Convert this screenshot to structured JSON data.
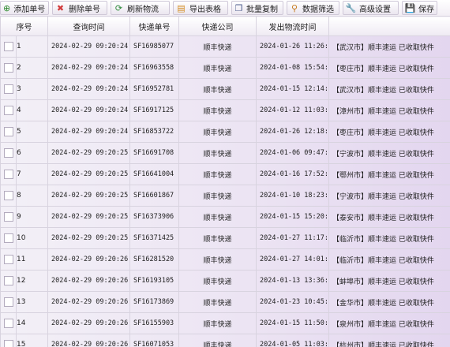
{
  "toolbar": [
    {
      "label": "添加单号",
      "icon": "add-icon",
      "glyph": "⊕",
      "color": "#2e8b2e"
    },
    {
      "label": "删除单号",
      "icon": "delete-icon",
      "glyph": "✖",
      "color": "#d23b3b"
    },
    {
      "label": "刷新物流",
      "icon": "refresh-icon",
      "glyph": "⟳",
      "color": "#2f8a3a"
    },
    {
      "label": "导出表格",
      "icon": "export-icon",
      "glyph": "▤",
      "color": "#d38b1f"
    },
    {
      "label": "批量复制",
      "icon": "copy-icon",
      "glyph": "❐",
      "color": "#4a5a8a"
    },
    {
      "label": "数据筛选",
      "icon": "filter-icon",
      "glyph": "⚲",
      "color": "#c67a1c"
    },
    {
      "label": "高级设置",
      "icon": "wrench-icon",
      "glyph": "🔧",
      "color": "#6a6a6a"
    },
    {
      "label": "保存",
      "icon": "save-icon",
      "glyph": "💾",
      "color": "#2f5fa8"
    }
  ],
  "table": {
    "headers": [
      "序号",
      "查询时间",
      "快递单号",
      "快递公司",
      "发出物流时间",
      ""
    ],
    "rows": [
      {
        "idx": "1",
        "time": "2024-02-29 09:20:24",
        "num": "SF16985077",
        "co": "顺丰快递",
        "sent": "2024-01-26 11:26:0",
        "loc": "【武汉市】顺丰速运 已收取快件"
      },
      {
        "idx": "2",
        "time": "2024-02-29 09:20:24",
        "num": "SF16963558",
        "co": "顺丰快递",
        "sent": "2024-01-08 15:54:4",
        "loc": "【枣庄市】顺丰速运 已收取快件"
      },
      {
        "idx": "3",
        "time": "2024-02-29 09:20:24",
        "num": "SF16952781",
        "co": "顺丰快递",
        "sent": "2024-01-15 12:14:0",
        "loc": "【武汉市】顺丰速运 已收取快件"
      },
      {
        "idx": "4",
        "time": "2024-02-29 09:20:24",
        "num": "SF16917125",
        "co": "顺丰快递",
        "sent": "2024-01-12 11:03:3",
        "loc": "【漳州市】顺丰速运 已收取快件"
      },
      {
        "idx": "5",
        "time": "2024-02-29 09:20:24",
        "num": "SF16853722",
        "co": "顺丰快递",
        "sent": "2024-01-26 12:18:0",
        "loc": "【枣庄市】顺丰速运 已收取快件"
      },
      {
        "idx": "6",
        "time": "2024-02-29 09:20:25",
        "num": "SF16691708",
        "co": "顺丰快递",
        "sent": "2024-01-06 09:47:4",
        "loc": "【宁波市】顺丰速运 已收取快件"
      },
      {
        "idx": "7",
        "time": "2024-02-29 09:20:25",
        "num": "SF16641004",
        "co": "顺丰快递",
        "sent": "2024-01-16 17:52:4",
        "loc": "【鄂州市】顺丰速运 已收取快件"
      },
      {
        "idx": "8",
        "time": "2024-02-29 09:20:25",
        "num": "SF16601867",
        "co": "顺丰快递",
        "sent": "2024-01-10 18:23:4",
        "loc": "【宁波市】顺丰速运 已收取快件"
      },
      {
        "idx": "9",
        "time": "2024-02-29 09:20:25",
        "num": "SF16373906",
        "co": "顺丰快递",
        "sent": "2024-01-15 15:20:0",
        "loc": "【泰安市】顺丰速运 已收取快件"
      },
      {
        "idx": "10",
        "time": "2024-02-29 09:20:25",
        "num": "SF16371425",
        "co": "顺丰快递",
        "sent": "2024-01-27 11:17:5",
        "loc": "【临沂市】顺丰速运 已收取快件"
      },
      {
        "idx": "11",
        "time": "2024-02-29 09:20:26",
        "num": "SF16281520",
        "co": "顺丰快递",
        "sent": "2024-01-27 14:01:2",
        "loc": "【临沂市】顺丰速运 已收取快件"
      },
      {
        "idx": "12",
        "time": "2024-02-29 09:20:26",
        "num": "SF16193105",
        "co": "顺丰快递",
        "sent": "2024-01-13 13:36:1",
        "loc": "【蚌埠市】顺丰速运 已收取快件"
      },
      {
        "idx": "13",
        "time": "2024-02-29 09:20:26",
        "num": "SF16173869",
        "co": "顺丰快递",
        "sent": "2024-01-23 10:45:2",
        "loc": "【金华市】顺丰速运 已收取快件"
      },
      {
        "idx": "14",
        "time": "2024-02-29 09:20:26",
        "num": "SF16155903",
        "co": "顺丰快递",
        "sent": "2024-01-15 11:50:2",
        "loc": "【泉州市】顺丰速运 已收取快件"
      },
      {
        "idx": "15",
        "time": "2024-02-29 09:20:26",
        "num": "SF16071053",
        "co": "顺丰快递",
        "sent": "2024-01-05 11:03:3",
        "loc": "【杭州市】顺丰速运 已收取快件"
      }
    ]
  }
}
